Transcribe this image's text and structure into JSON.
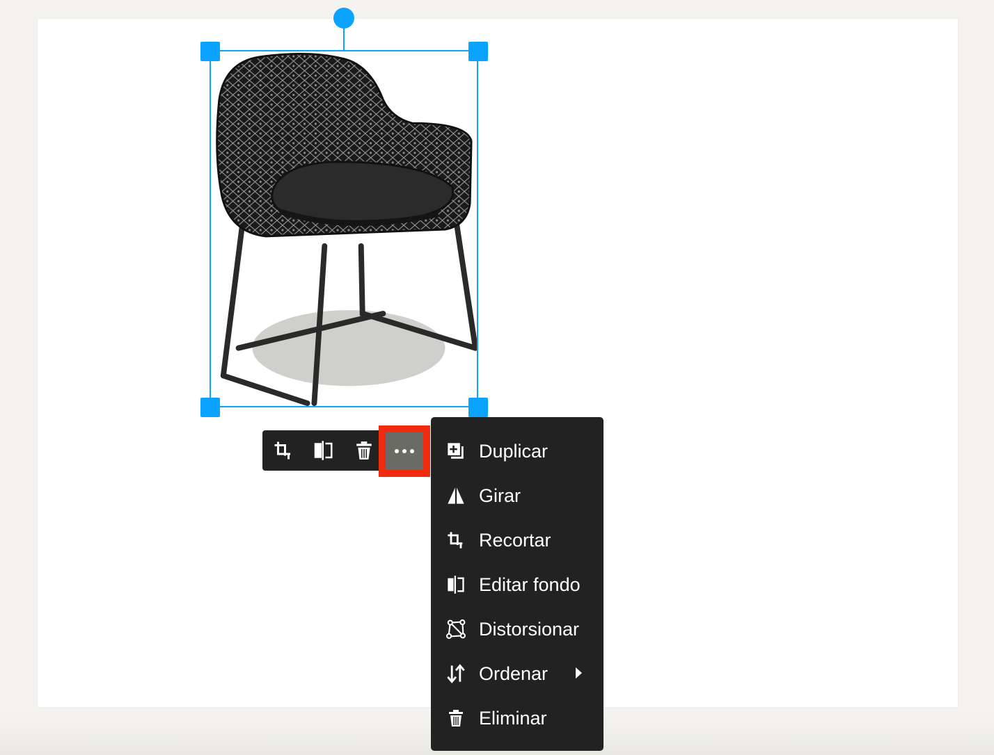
{
  "colors": {
    "selection": "#0aa3ff",
    "toolbar_bg": "#222222",
    "menu_bg": "#222222",
    "highlight": "#ee2a0f",
    "active_button": "#6b6b66",
    "page_bg": "#f4f3ef",
    "canvas_bg": "#ffffff"
  },
  "image": {
    "icon": "chair-image"
  },
  "toolbar": {
    "buttons": [
      {
        "icon": "crop-icon"
      },
      {
        "icon": "edit-background-icon"
      },
      {
        "icon": "trash-icon"
      },
      {
        "icon": "more-horizontal-icon"
      }
    ]
  },
  "menu": {
    "items": [
      {
        "label": "Duplicar",
        "icon": "duplicate-icon"
      },
      {
        "label": "Girar",
        "icon": "flip-icon"
      },
      {
        "label": "Recortar",
        "icon": "crop-icon"
      },
      {
        "label": "Editar fondo",
        "icon": "edit-background-icon"
      },
      {
        "label": "Distorsionar",
        "icon": "distort-icon"
      },
      {
        "label": "Ordenar",
        "icon": "sort-icon",
        "submenu_icon": "chevron-right-icon"
      },
      {
        "label": "Eliminar",
        "icon": "trash-icon"
      }
    ]
  }
}
